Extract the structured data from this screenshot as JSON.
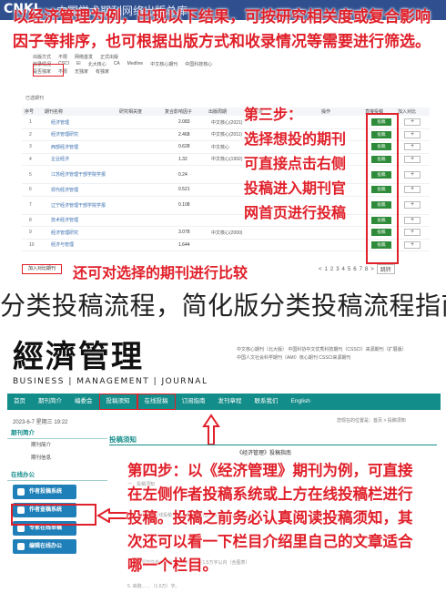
{
  "top": {
    "site_title": "CNKI",
    "site_subtitle": "中国学术期刊网络出版总库",
    "caption_line1": "以经济管理为例，出现以下结果，可按研究相关度或复合影响",
    "caption_line2": "因子等排序，也可根据出版方式和收录情况等需要进行筛选。",
    "filter": {
      "rows": [
        {
          "label": "出版方式",
          "options": [
            "不限",
            "网络首发",
            "正式出版"
          ]
        },
        {
          "label": "收录情况",
          "options": [
            "CSCI",
            "EI",
            "北大核心",
            "CA",
            "Medline",
            "中文核心期刊",
            "中国科技核心"
          ]
        },
        {
          "label": "是否独家",
          "options": [
            "不限",
            "无独家",
            "有独家"
          ]
        }
      ]
    },
    "selected_label": "已选期刊",
    "table_headers": [
      "序号",
      "期刊名称",
      "研究相关度",
      "复合影响因子",
      "出版周期",
      "收录",
      "操作",
      "直接投稿",
      "加入对比"
    ],
    "rows": [
      {
        "no": "1",
        "name": "经济管理",
        "value": "2.083",
        "cls": "中文核心(2021)"
      },
      {
        "no": "2",
        "name": "经济管理研究",
        "value": "2.468",
        "cls": "中文核心(2011)"
      },
      {
        "no": "3",
        "name": "西部经济管理",
        "value": "0.628",
        "cls": "中文核心"
      },
      {
        "no": "4",
        "name": "企业经济",
        "value": "1.32",
        "cls": "中文核心(1992)"
      },
      {
        "no": "5",
        "name": "江苏经济管理干部学院学报",
        "value": "0.24",
        "cls": ""
      },
      {
        "no": "6",
        "name": "现代经济管理",
        "value": "0.521",
        "cls": ""
      },
      {
        "no": "7",
        "name": "辽宁经济管理干部学院学报",
        "value": "0.108",
        "cls": ""
      },
      {
        "no": "8",
        "name": "技术经济管理",
        "value": "",
        "cls": ""
      },
      {
        "no": "9",
        "name": "经济管理研究",
        "value": "3.078",
        "cls": "中文核心(2000)"
      },
      {
        "no": "10",
        "name": "经济与管理",
        "value": "1.644",
        "cls": ""
      }
    ],
    "submit_label": "投稿",
    "plus_label": "+",
    "step3_lines": [
      "第三步：",
      "选择想投的期刊",
      "可直接点击右侧",
      "投稿进入期刊官",
      "网首页进行投稿"
    ],
    "compare_button": "加入对比期刊",
    "compare_text": "还可对选择的期刊进行比较",
    "pager": [
      "<",
      "1",
      "2",
      "3",
      "4",
      "5",
      "6",
      "7",
      "8",
      ">",
      "跳转"
    ]
  },
  "heading": "分类投稿流程，简化版分类投稿流程指南",
  "bottom": {
    "logo": "經濟管理",
    "logo_en": "BUSINESS | MANAGEMENT | JOURNAL",
    "info_lines": [
      "中文核心期刊（北大版）    中国科协中文优秀科技期刊（CSSCI）来源期刊（扩展版）",
      "中国人文社会科学期刊（AMI）核心期刊    CSSCI来源期刊"
    ],
    "nav": [
      "首页",
      "期刊简介",
      "编委会",
      "投稿须知",
      "在线投稿",
      "订阅指南",
      "发刊章程",
      "联系我们",
      "English"
    ],
    "nav_boxed": [
      3,
      4
    ],
    "date": "2023-6-7 星期三 19:22",
    "crumb": "您现在的位置是：首页 > 投稿须知",
    "left_sections": [
      {
        "title": "期刊简介",
        "items": [
          "期刊简介",
          "期刊信息"
        ]
      },
      {
        "title": "在线办公",
        "items": []
      }
    ],
    "buttons": [
      "作者投稿系统",
      "作者查稿系统",
      "专家在线审稿",
      "编辑在线办公"
    ],
    "main_title": "投稿须知",
    "guide_title": "《经济管理》投稿指南",
    "step4_lines": [
      "第四步：以《经济管理》期刊为例，可直接",
      "在左侧作者投稿系统或上方在线投稿栏进行",
      "投稿。投稿之前务必认真阅读投稿须知，其",
      "次还可以看一下栏目介绍里自己的文章适合",
      "哪一个栏目。"
    ],
    "faint_lines": [
      "一、投稿须知",
      "1.本刊只接受在线投稿，请作者注册后登录投稿系统。",
      "（包括规范性参考文献），字数一般在1.5万字以内（含图表）",
      "5. 来稿……（1.6万）字。"
    ]
  }
}
